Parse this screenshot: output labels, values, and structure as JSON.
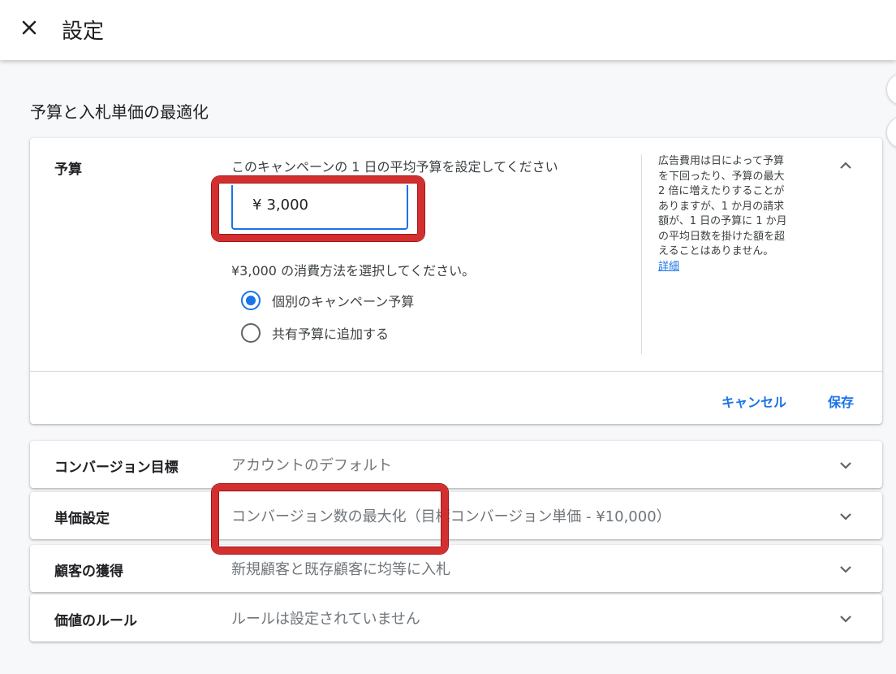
{
  "header": {
    "title": "設定"
  },
  "section": {
    "title": "予算と入札単価の最適化"
  },
  "budget": {
    "label": "予算",
    "prompt": "このキャンペーンの 1 日の平均予算を設定してください",
    "currency": "¥",
    "value": "3,000",
    "spend_prompt": "¥3,000 の消費方法を選択してください。",
    "options": [
      {
        "label": "個別のキャンペーン予算",
        "checked": true
      },
      {
        "label": "共有予算に追加する",
        "checked": false
      }
    ],
    "help_lines": [
      "広告費用は日によって予算",
      "を下回ったり、予算の最大",
      "2 倍に増えたりすることが",
      "ありますが、1 か月の請求",
      "額が、1 日の予算に 1 か月",
      "の平均日数を掛けた額を超",
      "えることはありません。"
    ],
    "help_link": "詳細",
    "cancel_label": "キャンセル",
    "save_label": "保存"
  },
  "rows": [
    {
      "label": "コンバージョン目標",
      "value": "アカウントのデフォルト"
    },
    {
      "label": "単価設定",
      "value": "コンバージョン数の最大化（目標コンバージョン単価 - ¥10,000）"
    },
    {
      "label": "顧客の獲得",
      "value": "新規顧客と既存顧客に均等に入札"
    },
    {
      "label": "価値のルール",
      "value": "ルールは設定されていません"
    }
  ],
  "colors": {
    "accent": "#1a73e8",
    "highlight": "#d32f2f"
  },
  "icons": {
    "close": "close-icon",
    "expand_less": "chevron-up-icon",
    "expand_more": "chevron-down-icon"
  }
}
